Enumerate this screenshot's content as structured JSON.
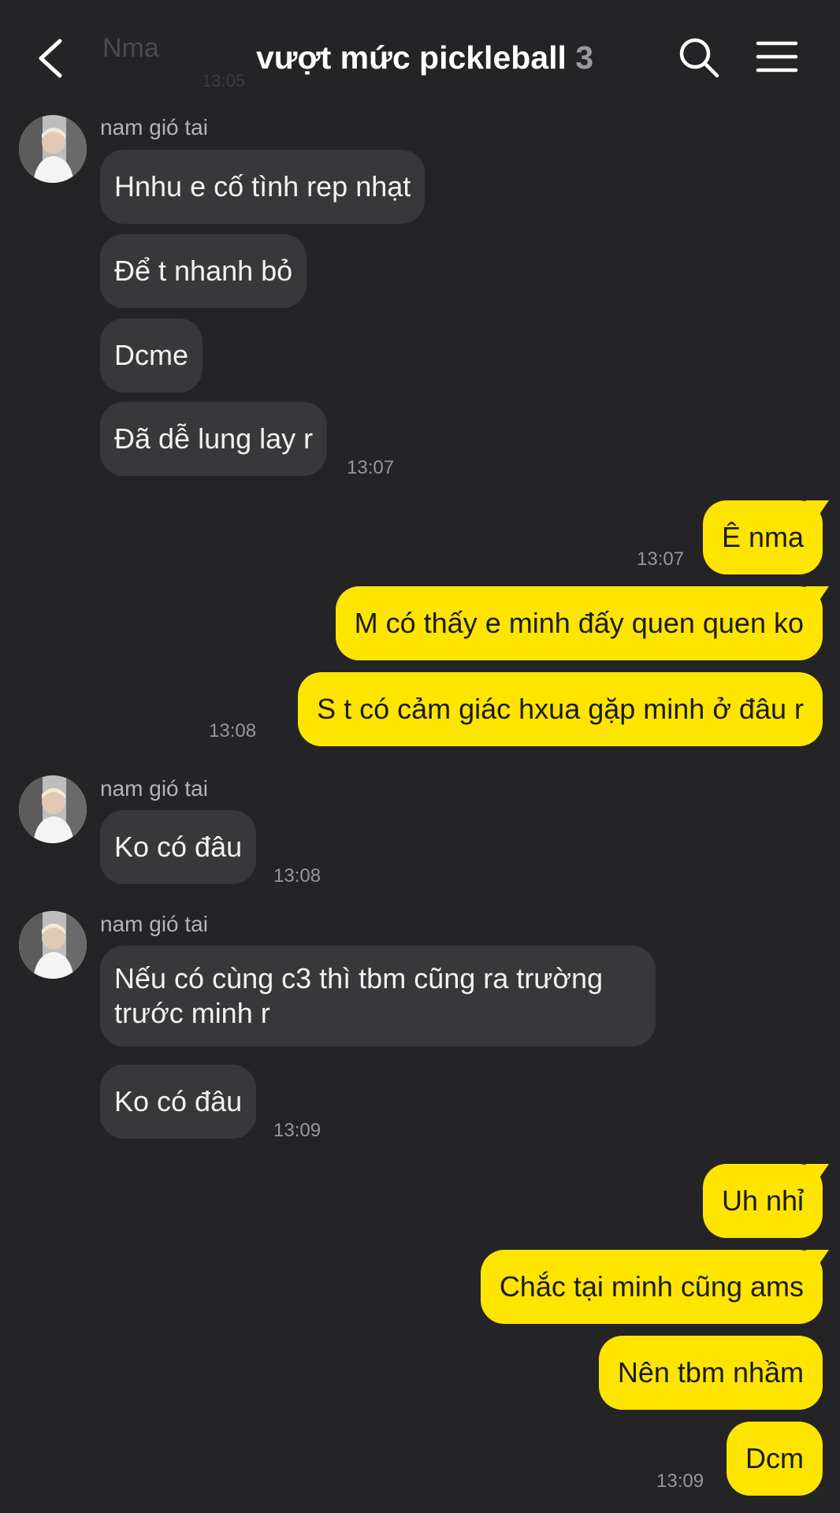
{
  "header": {
    "title": "vượt mức pickleball",
    "member_count": "3",
    "ghost_message": "Nma",
    "ghost_time": "13:05"
  },
  "colors": {
    "background": "#242426",
    "incoming_bubble": "#38383b",
    "outgoing_bubble": "#fee500"
  },
  "icons": {
    "back": "chevron-left-icon",
    "search": "search-icon",
    "menu": "hamburger-menu-icon"
  },
  "messages": {
    "group1": {
      "sender": "nam gió tai",
      "m1": "Hnhu e cố tình rep nhạt",
      "m2": "Để t nhanh bỏ",
      "m3": "Dcme",
      "m4": "Đã dễ lung lay r",
      "time": "13:07"
    },
    "me1": {
      "m1": "Ê nma",
      "time1": "13:07",
      "m2": "M có thấy e minh đấy quen quen ko",
      "m3": "S t có cảm giác hxua gặp minh ở đâu r",
      "time2": "13:08"
    },
    "group2": {
      "sender": "nam gió tai",
      "m1": "Ko có đâu",
      "time": "13:08"
    },
    "group3": {
      "sender": "nam gió tai",
      "m1": "Nếu có cùng c3 thì tbm cũng ra trường trước minh r",
      "m2": "Ko có đâu",
      "time": "13:09"
    },
    "me2": {
      "m1": "Uh nhỉ",
      "m2": "Chắc tại minh cũng ams",
      "m3": "Nên tbm nhầm",
      "m4": "Dcm",
      "time": "13:09"
    }
  }
}
